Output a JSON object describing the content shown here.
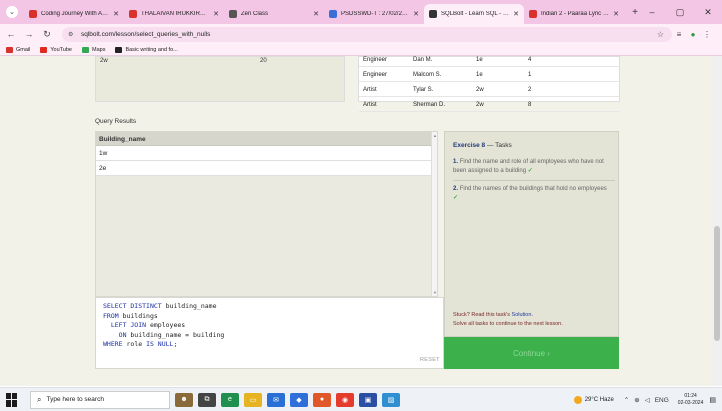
{
  "browser": {
    "tabs": [
      {
        "title": "Coding Journey With Aless",
        "color": "#d9312b"
      },
      {
        "title": "THALAIVAN IRUKKIRAN | T",
        "color": "#d9312b"
      },
      {
        "title": "Zen Class",
        "color": "#555555"
      },
      {
        "title": "PSDSSWD-T : 27/02/2024",
        "color": "#3b6fd8"
      },
      {
        "title": "SQLBolt - Learn SQL - SQL",
        "color": "#333333"
      },
      {
        "title": "Indian 2 - Paaraa Lyric Vid",
        "color": "#d9312b"
      }
    ],
    "active_tab": 4,
    "url": "sqlbolt.com/lesson/select_queries_with_nulls",
    "bookmarks": [
      {
        "label": "Gmail",
        "color": "#d9312b"
      },
      {
        "label": "YouTube",
        "color": "#e02a20"
      },
      {
        "label": "Maps",
        "color": "#34a853"
      },
      {
        "label": "Basic writing and fo...",
        "color": "#222222"
      }
    ]
  },
  "top_table": {
    "left_row": {
      "building": "2w",
      "capacity": "20"
    },
    "employees": [
      {
        "role": "Engineer",
        "name": "Dan M.",
        "building": "1e",
        "years": "4"
      },
      {
        "role": "Engineer",
        "name": "Malcom S.",
        "building": "1e",
        "years": "1"
      },
      {
        "role": "Artist",
        "name": "Tylar S.",
        "building": "2w",
        "years": "2"
      },
      {
        "role": "Artist",
        "name": "Sherman D.",
        "building": "2w",
        "years": "8"
      }
    ]
  },
  "query_results": {
    "label": "Query Results",
    "column": "Building_name",
    "rows": [
      "1w",
      "2e"
    ]
  },
  "editor": {
    "lines": [
      [
        {
          "t": "SELECT DISTINCT",
          "kw": true
        },
        {
          "t": " building_name",
          "kw": false
        }
      ],
      [
        {
          "t": "FROM",
          "kw": true
        },
        {
          "t": " buildings",
          "kw": false
        }
      ],
      [
        {
          "t": "  LEFT JOIN",
          "kw": true
        },
        {
          "t": " employees",
          "kw": false
        }
      ],
      [
        {
          "t": "    ON",
          "kw": true
        },
        {
          "t": " building_name = building",
          "kw": false
        }
      ],
      [
        {
          "t": "WHERE",
          "kw": true
        },
        {
          "t": " role ",
          "kw": false
        },
        {
          "t": "IS NULL",
          "kw": true
        },
        {
          "t": ";",
          "kw": false
        }
      ]
    ],
    "reset_label": "RESET"
  },
  "exercise": {
    "title": "Exercise 8",
    "title_suffix": " — Tasks",
    "tasks": [
      {
        "num": "1.",
        "text": "Find the name and role of all employees who have not been assigned to a building",
        "done": "✓"
      },
      {
        "num": "2.",
        "text": "Find the names of the buildings that hold no employees",
        "done": "✓"
      }
    ],
    "stuck_prefix": "Stuck? Read this task's ",
    "stuck_link": "Solution",
    "stuck_suffix": ".",
    "solve_text": "Solve all tasks to continue to the next lesson.",
    "continue_label": "Continue ›"
  },
  "taskbar": {
    "search_placeholder": "Type here to search",
    "weather": "29°C  Haze",
    "lang": "ENG",
    "time": "01:24",
    "date": "02-03-2024"
  }
}
